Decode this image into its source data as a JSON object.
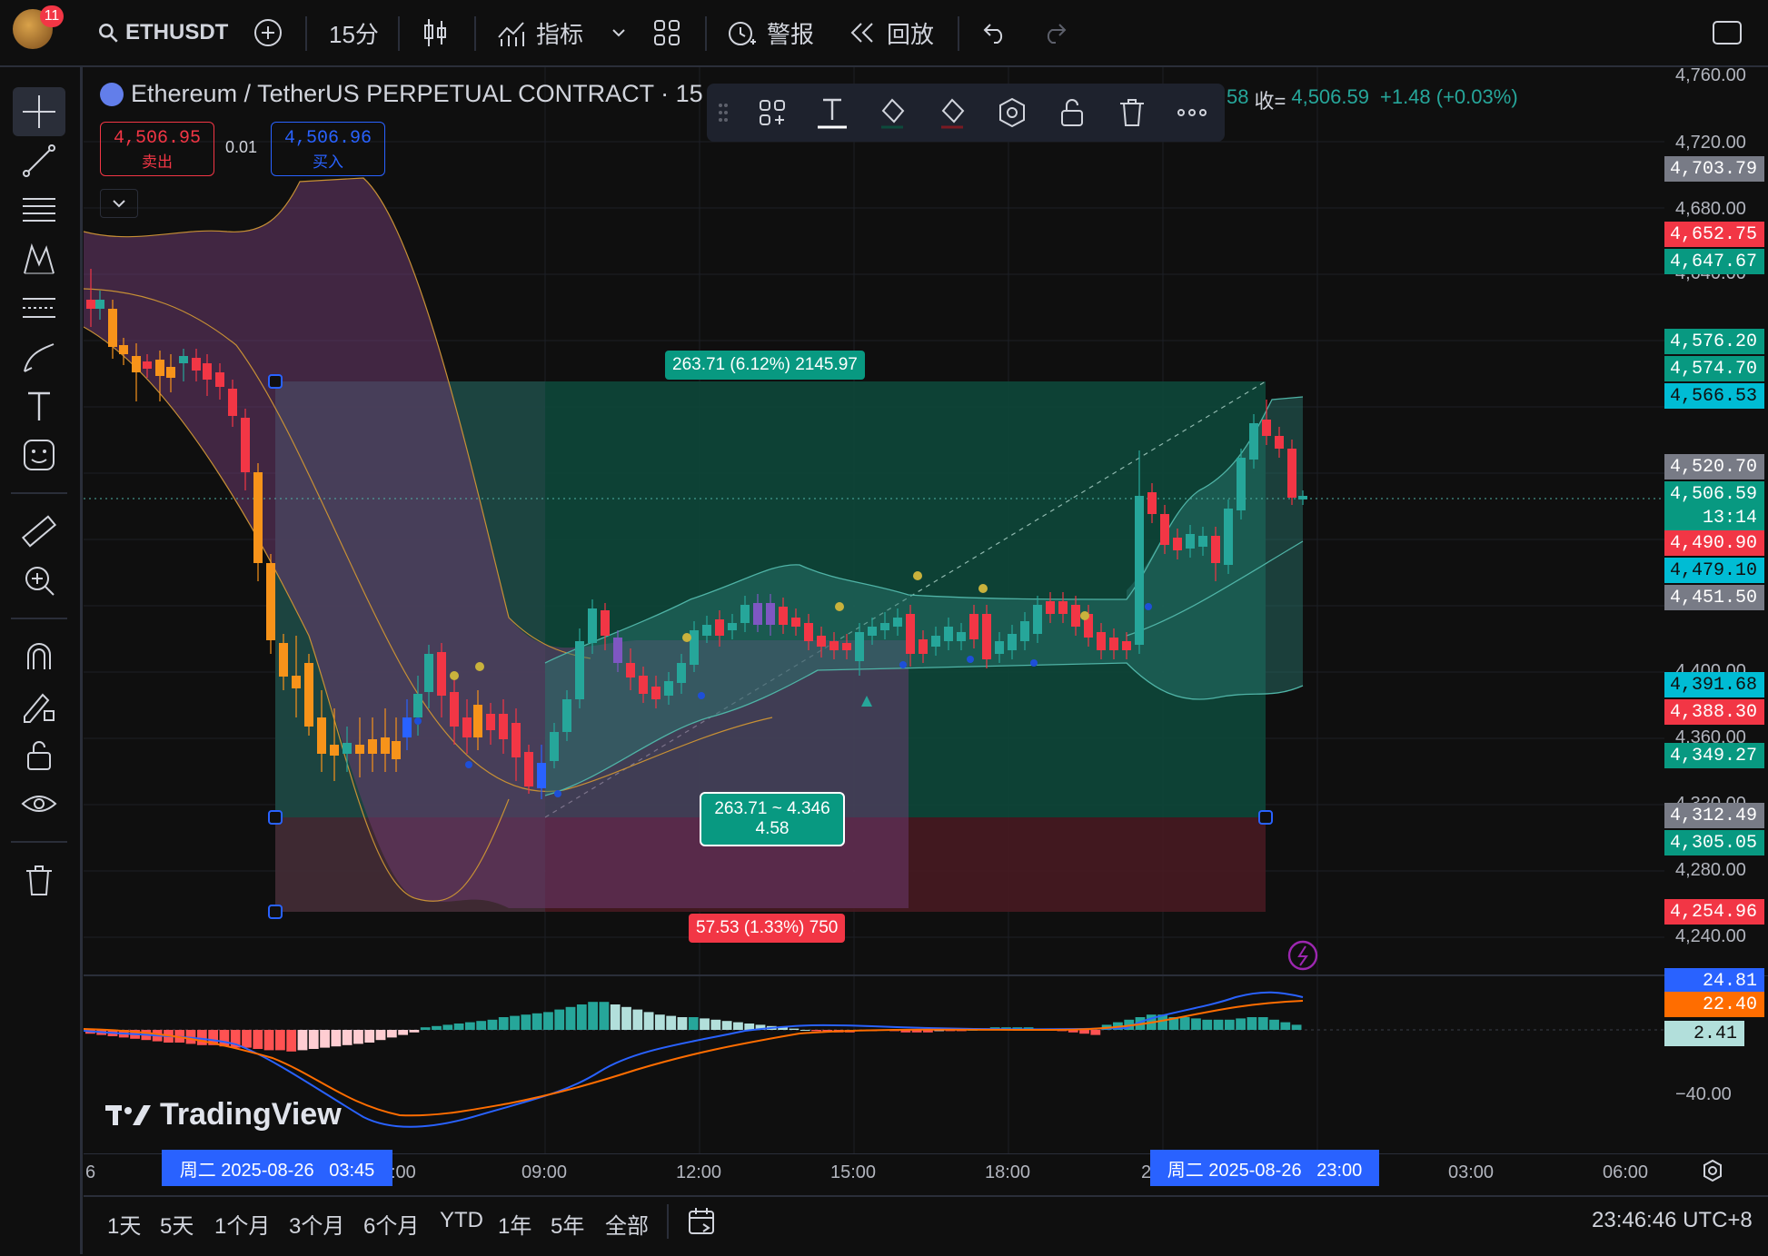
{
  "header": {
    "notification_count": "11",
    "symbol": "ETHUSDT",
    "interval": "15分",
    "indicators_label": "指标",
    "alerts_label": "警报",
    "replay_label": "回放"
  },
  "legend": {
    "title": "Ethereum / TetherUS PERPETUAL CONTRACT · 15 ·",
    "ohlc_fragment": "58",
    "close_label": "收=",
    "close_value": "4,506.59",
    "change": "+1.48 (+0.03%)",
    "sell_price": "4,506.95",
    "sell_label": "卖出",
    "spread": "0.01",
    "buy_price": "4,506.96",
    "buy_label": "买入"
  },
  "price_axis": {
    "ticks": [
      "4,760.00",
      "4,720.00",
      "4,680.00",
      "4,640.00",
      "4,400.00",
      "4,360.00",
      "4,320.00",
      "4,280.00",
      "4,240.00"
    ],
    "labels": [
      {
        "text": "4,703.79",
        "bg": "#787b86",
        "fg": "#ffffff"
      },
      {
        "text": "4,652.75",
        "bg": "#f23645",
        "fg": "#ffffff"
      },
      {
        "text": "4,647.67",
        "bg": "#089981",
        "fg": "#ffffff"
      },
      {
        "text": "4,576.20",
        "bg": "#089981",
        "fg": "#ffffff"
      },
      {
        "text": "4,574.70",
        "bg": "#089981",
        "fg": "#ffffff"
      },
      {
        "text": "4,566.53",
        "bg": "#00bcd4",
        "fg": "#0f0f0f"
      },
      {
        "text": "4,520.70",
        "bg": "#787b86",
        "fg": "#ffffff"
      },
      {
        "text": "4,506.59",
        "bg": "#089981",
        "fg": "#ffffff"
      },
      {
        "text": "13:14",
        "bg": "#089981",
        "fg": "#ffffff"
      },
      {
        "text": "4,490.90",
        "bg": "#f23645",
        "fg": "#ffffff"
      },
      {
        "text": "4,479.10",
        "bg": "#00bcd4",
        "fg": "#0f0f0f"
      },
      {
        "text": "4,451.50",
        "bg": "#787b86",
        "fg": "#ffffff"
      },
      {
        "text": "4,391.68",
        "bg": "#00bcd4",
        "fg": "#0f0f0f"
      },
      {
        "text": "4,388.30",
        "bg": "#f23645",
        "fg": "#ffffff"
      },
      {
        "text": "4,349.27",
        "bg": "#089981",
        "fg": "#ffffff"
      },
      {
        "text": "4,312.49",
        "bg": "#787b86",
        "fg": "#ffffff"
      },
      {
        "text": "4,305.05",
        "bg": "#089981",
        "fg": "#ffffff"
      },
      {
        "text": "4,254.96",
        "bg": "#f23645",
        "fg": "#ffffff"
      }
    ],
    "macd_labels": [
      {
        "text": "24.81",
        "bg": "#2962ff",
        "fg": "#ffffff"
      },
      {
        "text": "22.40",
        "bg": "#ff6d00",
        "fg": "#ffffff"
      },
      {
        "text": "2.41",
        "bg": "#b2dfdb",
        "fg": "#0f0f0f"
      }
    ],
    "macd_tick": "−40.00"
  },
  "position": {
    "target_label": "263.71 (6.12%) 2145.97",
    "center_label_line1": "263.71 ~ 4.346",
    "center_label_line2": "4.58",
    "stop_label": "57.53 (1.33%) 750"
  },
  "time_axis": {
    "ticks": [
      "6",
      ":00",
      "09:00",
      "12:00",
      "15:00",
      "18:00",
      "2",
      "03:00",
      "06:00"
    ],
    "cursor_start": "周二 2025-08-26   03:45",
    "cursor_end": "周二 2025-08-26   23:00"
  },
  "bottom": {
    "ranges": [
      "1天",
      "5天",
      "1个月",
      "3个月",
      "6个月",
      "YTD",
      "1年",
      "5年",
      "全部"
    ],
    "clock": "23:46:46 UTC+8"
  },
  "watermark": "TradingView",
  "colors": {
    "up": "#26a69a",
    "down": "#ef5350",
    "bg": "#0f0f0f",
    "accent": "#2962ff"
  }
}
